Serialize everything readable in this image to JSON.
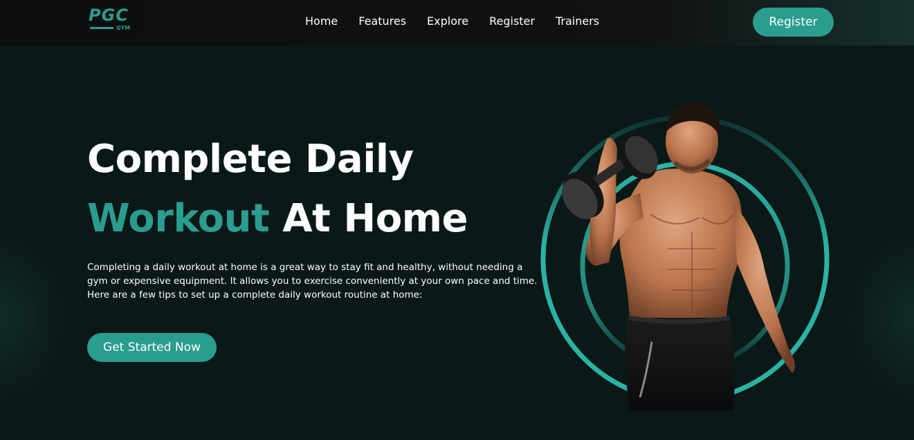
{
  "logo": {
    "text": "PGC",
    "sub": "GYM"
  },
  "nav": {
    "links": [
      "Home",
      "Features",
      "Explore",
      "Register",
      "Trainers"
    ],
    "register_button": "Register"
  },
  "hero": {
    "title_line1": "Complete Daily",
    "title_accent": "Workout",
    "title_rest": " At Home",
    "description": "Completing a daily workout at home is a great way to stay fit and healthy, without needing a gym or expensive equipment. It allows you to exercise conveniently at your own pace and time. Here are a few tips to set up a complete daily workout routine at home:",
    "cta": "Get Started Now"
  },
  "colors": {
    "accent": "#2a9d8f",
    "background": "#0a1818",
    "navbar": "#0e0e0e"
  },
  "icons": {
    "logo": "pgc-gym-logo",
    "hero_image": "man-with-dumbbell-image"
  }
}
